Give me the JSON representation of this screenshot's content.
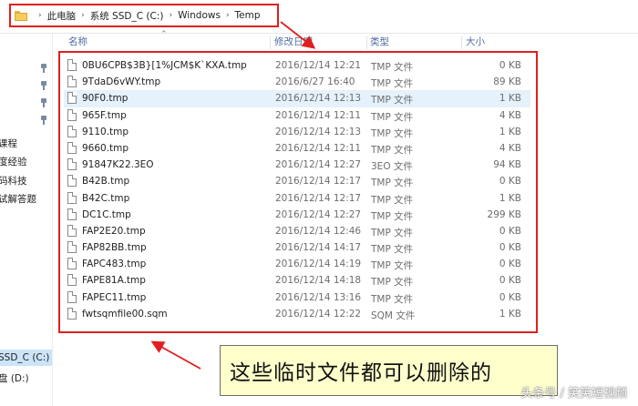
{
  "address_bar": {
    "crumbs": [
      "此电脑",
      "系统 SSD_C (C:)",
      "Windows",
      "Temp"
    ]
  },
  "nav": {
    "items": [
      "课程",
      "度经验",
      "码科技",
      "试解答题"
    ],
    "drives": [
      "SSD_C (C:)",
      "盘 (D:)"
    ]
  },
  "columns": {
    "name": "名称",
    "date": "修改日期",
    "type": "类型",
    "size": "大小"
  },
  "files": [
    {
      "name": "0BU6CPB$3B}[1%JCM$K`KXA.tmp",
      "date": "2016/12/14 12:21",
      "type": "TMP 文件",
      "size": "0 KB"
    },
    {
      "name": "9TdaD6vWY.tmp",
      "date": "2016/6/27 16:40",
      "type": "TMP 文件",
      "size": "89 KB"
    },
    {
      "name": "90F0.tmp",
      "date": "2016/12/14 12:13",
      "type": "TMP 文件",
      "size": "1 KB"
    },
    {
      "name": "965F.tmp",
      "date": "2016/12/14 12:11",
      "type": "TMP 文件",
      "size": "4 KB"
    },
    {
      "name": "9110.tmp",
      "date": "2016/12/14 12:13",
      "type": "TMP 文件",
      "size": "1 KB"
    },
    {
      "name": "9660.tmp",
      "date": "2016/12/14 12:11",
      "type": "TMP 文件",
      "size": "4 KB"
    },
    {
      "name": "91847K22.3EO",
      "date": "2016/12/14 12:27",
      "type": "3EO 文件",
      "size": "94 KB"
    },
    {
      "name": "B42B.tmp",
      "date": "2016/12/14 12:17",
      "type": "TMP 文件",
      "size": "0 KB"
    },
    {
      "name": "B42C.tmp",
      "date": "2016/12/14 12:17",
      "type": "TMP 文件",
      "size": "1 KB"
    },
    {
      "name": "DC1C.tmp",
      "date": "2016/12/14 12:27",
      "type": "TMP 文件",
      "size": "299 KB"
    },
    {
      "name": "FAP2E20.tmp",
      "date": "2016/12/14 12:46",
      "type": "TMP 文件",
      "size": "0 KB"
    },
    {
      "name": "FAP82BB.tmp",
      "date": "2016/12/14 14:17",
      "type": "TMP 文件",
      "size": "0 KB"
    },
    {
      "name": "FAPC483.tmp",
      "date": "2016/12/14 14:19",
      "type": "TMP 文件",
      "size": "0 KB"
    },
    {
      "name": "FAPE81A.tmp",
      "date": "2016/12/14 14:18",
      "type": "TMP 文件",
      "size": "0 KB"
    },
    {
      "name": "FAPEC11.tmp",
      "date": "2016/12/14 13:16",
      "type": "TMP 文件",
      "size": "0 KB"
    },
    {
      "name": "fwtsqmfile00.sqm",
      "date": "2016/12/14 12:22",
      "type": "SQM 文件",
      "size": "1 KB"
    }
  ],
  "selected_index": 2,
  "callout": {
    "text": "这些临时文件都可以删除的"
  },
  "watermark": "头条号 / 笑笑短视频",
  "colors": {
    "annotation_red": "#e02020",
    "callout_bg": "#ffffcc",
    "selection": "#e5f1fb",
    "header_text": "#4d6ba0"
  },
  "icons": {
    "folder": "folder-icon",
    "file": "file-icon",
    "pin": "pin-icon"
  }
}
